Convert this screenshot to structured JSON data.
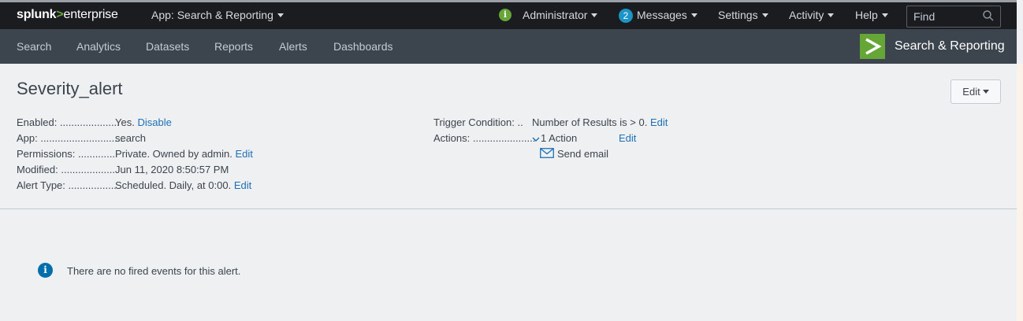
{
  "topbar": {
    "brand_main": "splunk",
    "brand_sep": ">",
    "brand_sub": "enterprise",
    "app_menu": "App: Search & Reporting",
    "user": "Administrator",
    "messages_count": "2",
    "messages": "Messages",
    "settings": "Settings",
    "activity": "Activity",
    "help": "Help",
    "find_placeholder": "Find"
  },
  "appbar": {
    "nav": [
      "Search",
      "Analytics",
      "Datasets",
      "Reports",
      "Alerts",
      "Dashboards"
    ],
    "app_title": "Search & Reporting"
  },
  "alert": {
    "title": "Severity_alert",
    "edit_button": "Edit",
    "left": [
      {
        "label": "Enabled: .....................",
        "value": "Yes.",
        "link": "Disable"
      },
      {
        "label": "App: .............................",
        "value": "search",
        "link": ""
      },
      {
        "label": "Permissions: .............",
        "value": "Private. Owned by admin.",
        "link": "Edit"
      },
      {
        "label": "Modified: ...................",
        "value": "Jun 11, 2020 8:50:57 PM",
        "link": ""
      },
      {
        "label": "Alert Type: .................",
        "value": "Scheduled. Daily, at 0:00.",
        "link": "Edit"
      }
    ],
    "trigger_label": "Trigger Condition: ..",
    "trigger_value": "Number of Results is > 0.",
    "trigger_link": "Edit",
    "actions_label": "Actions: ......................",
    "actions_value": "1 Action",
    "actions_link": "Edit",
    "action_item": "Send email"
  },
  "empty_state": {
    "message": "There are no fired events for this alert."
  }
}
